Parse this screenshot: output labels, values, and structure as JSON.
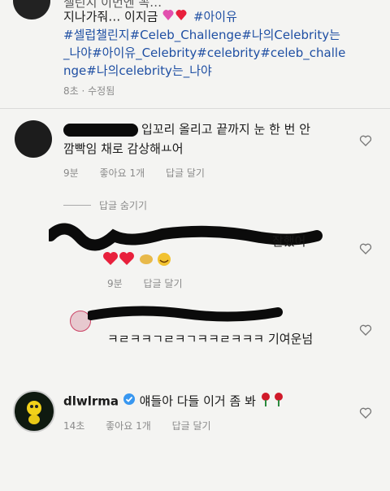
{
  "caption": {
    "line0": "챌린지 이번엔 꼭…",
    "line1_text": "지나가줘… 이지금",
    "line1_tag": "#아이유",
    "line2": "#셀럽챌린지#Celeb_Challenge#나의Celebrity는",
    "line3": "_나야#아이유_Celebrity#celebrity#celeb_challe",
    "line4": "nge#나의celebrity는_나야",
    "meta": "8초 · 수정됨"
  },
  "comments": [
    {
      "text_line1": "입꼬리 올리고 끝까지 눈 한 번 안",
      "text_line2": "깜빡임 채로 감상해ㅛ어",
      "time": "9분",
      "likes": "좋아요 1개",
      "reply": "답글 달기"
    }
  ],
  "hide_replies": "답글 숨기기",
  "replies": [
    {
      "text": "잘했어",
      "time": "9분",
      "reply": "답글 달기"
    },
    {
      "text": "ㅋㄹㅋㅋㄱㄹㅋㄱㅋㅋㄹㅋㅋㅋ 기여운넘"
    }
  ],
  "final_comment": {
    "username": "dlwlrma",
    "text": "얘들아 다들 이거 좀 봐",
    "time": "14초",
    "likes": "좋아요 1개",
    "reply": "답글 달기"
  },
  "colors": {
    "hashtag": "#1f4fa3",
    "verified": "#3897f0",
    "heart_red": "#e8203c"
  }
}
